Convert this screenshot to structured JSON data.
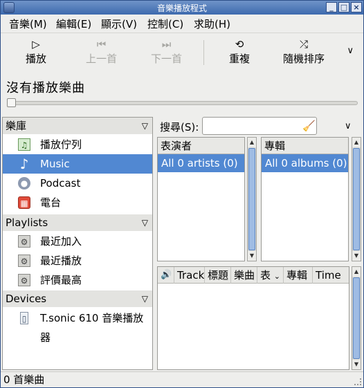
{
  "window": {
    "title": "音樂播放程式"
  },
  "menubar": [
    {
      "label": "音樂(M)"
    },
    {
      "label": "編輯(E)"
    },
    {
      "label": "顯示(V)"
    },
    {
      "label": "控制(C)"
    },
    {
      "label": "求助(H)"
    }
  ],
  "toolbar": {
    "play": "播放",
    "prev": "上一首",
    "next": "下一首",
    "repeat": "重複",
    "shuffle": "隨機排序"
  },
  "now_playing": "沒有播放樂曲",
  "sidebar": {
    "library_header": "樂庫",
    "library": [
      {
        "label": "播放佇列",
        "icon": "playlist-icon"
      },
      {
        "label": "Music",
        "icon": "music-note-icon",
        "selected": true
      },
      {
        "label": "Podcast",
        "icon": "podcast-icon"
      },
      {
        "label": "電台",
        "icon": "radio-icon"
      }
    ],
    "playlists_header": "Playlists",
    "playlists": [
      {
        "label": "最近加入"
      },
      {
        "label": "最近播放"
      },
      {
        "label": "評價最高"
      }
    ],
    "devices_header": "Devices",
    "devices": [
      {
        "label": "T.sonic 610 音樂播放器"
      }
    ]
  },
  "search": {
    "label": "搜尋(S):",
    "value": ""
  },
  "browser": {
    "artists_header": "表演者",
    "artists_all": "All 0 artists (0)",
    "albums_header": "專輯",
    "albums_all": "All 0 albums (0)"
  },
  "tracklist": {
    "columns": [
      "Track",
      "標題",
      "樂曲",
      "表",
      "專輯",
      "Time"
    ]
  },
  "status": "0 首樂曲",
  "colors": {
    "selection": "#5188d2",
    "titlebar": "#3d6aae"
  }
}
